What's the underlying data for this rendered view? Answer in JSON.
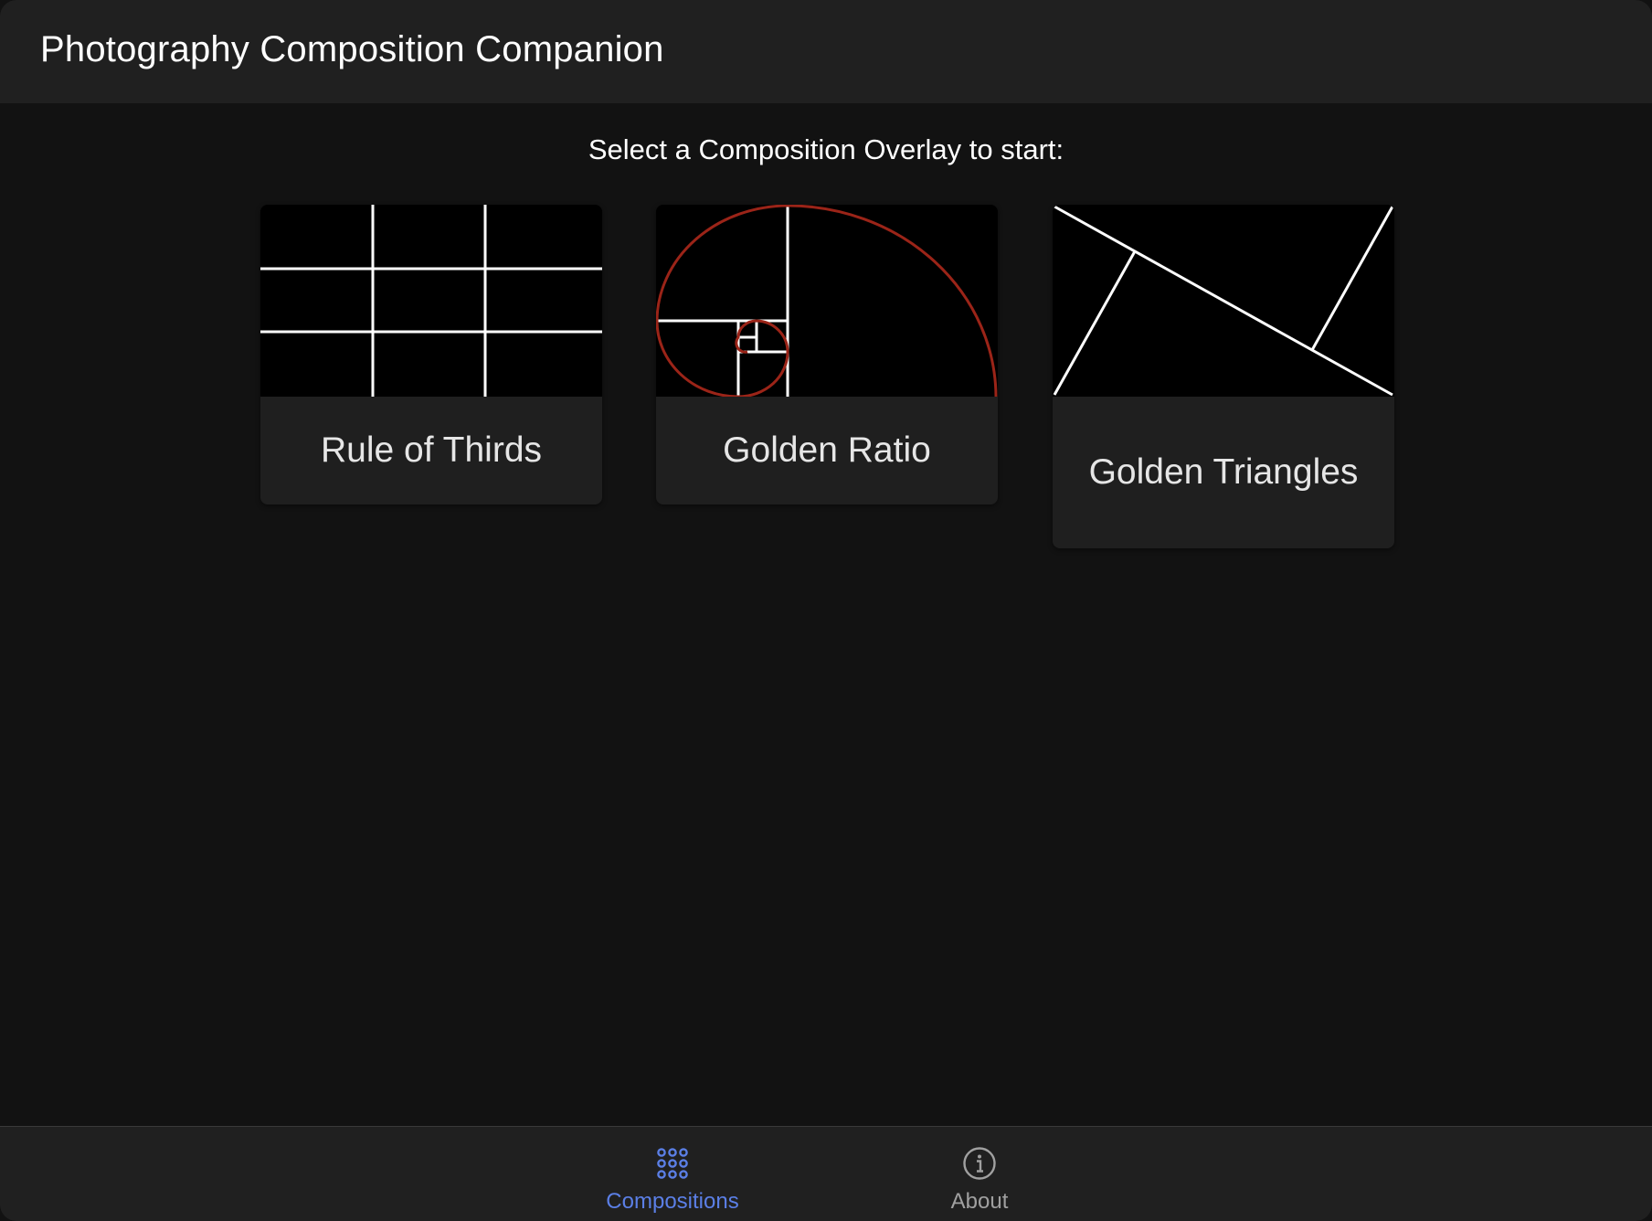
{
  "header": {
    "title": "Photography Composition Companion"
  },
  "main": {
    "prompt": "Select a Composition Overlay to start:",
    "cards": [
      {
        "label": "Rule of Thirds",
        "icon": "rule-of-thirds-grid-icon"
      },
      {
        "label": "Golden Ratio",
        "icon": "golden-spiral-icon"
      },
      {
        "label": "Golden Triangles",
        "icon": "golden-triangles-icon"
      }
    ]
  },
  "tabbar": {
    "tabs": [
      {
        "label": "Compositions",
        "icon": "grid-dots-icon",
        "active": true
      },
      {
        "label": "About",
        "icon": "info-icon",
        "active": false
      }
    ]
  },
  "colors": {
    "background": "#121212",
    "bar": "#202020",
    "card": "#1f1f1f",
    "accent": "#5b7fe6",
    "inactive": "#a0a0a0",
    "spiral": "#9b2418"
  }
}
